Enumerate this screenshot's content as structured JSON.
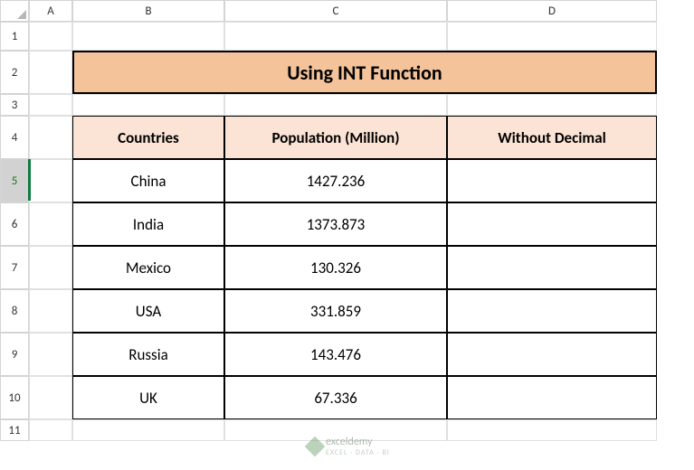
{
  "columns": [
    "A",
    "B",
    "C",
    "D"
  ],
  "rows": [
    "1",
    "2",
    "3",
    "4",
    "5",
    "6",
    "7",
    "8",
    "9",
    "10",
    "11"
  ],
  "activeRow": "5",
  "title": "Using INT Function",
  "headers": {
    "col1": "Countries",
    "col2": "Population (Million)",
    "col3": "Without Decimal"
  },
  "data": [
    {
      "country": "China",
      "population": "1427.236",
      "withoutDecimal": ""
    },
    {
      "country": "India",
      "population": "1373.873",
      "withoutDecimal": ""
    },
    {
      "country": "Mexico",
      "population": "130.326",
      "withoutDecimal": ""
    },
    {
      "country": "USA",
      "population": "331.859",
      "withoutDecimal": ""
    },
    {
      "country": "Russia",
      "population": "143.476",
      "withoutDecimal": ""
    },
    {
      "country": "UK",
      "population": "67.336",
      "withoutDecimal": ""
    }
  ],
  "watermark": {
    "name": "exceldemy",
    "tagline": "EXCEL · DATA · BI"
  },
  "chart_data": {
    "type": "table",
    "title": "Using INT Function",
    "columns": [
      "Countries",
      "Population (Million)",
      "Without Decimal"
    ],
    "rows": [
      [
        "China",
        1427.236,
        null
      ],
      [
        "India",
        1373.873,
        null
      ],
      [
        "Mexico",
        130.326,
        null
      ],
      [
        "USA",
        331.859,
        null
      ],
      [
        "Russia",
        143.476,
        null
      ],
      [
        "UK",
        67.336,
        null
      ]
    ]
  }
}
